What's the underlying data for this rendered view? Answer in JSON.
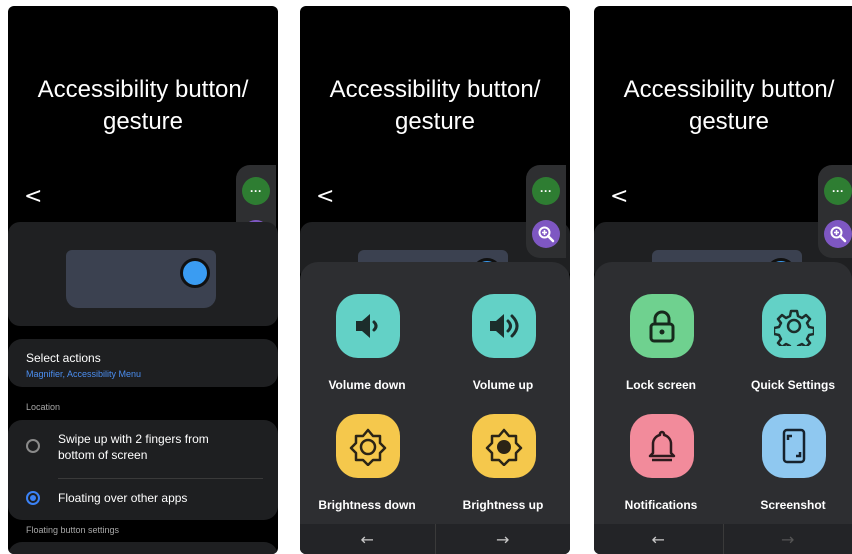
{
  "screen_title": "Accessibility button/ gesture",
  "title_line1": "Accessibility button/",
  "title_line2": "gesture",
  "back_glyph": "<",
  "float_menu_dots": "···",
  "settings": {
    "select_actions_title": "Select actions",
    "select_actions_value": "Magnifier, Accessibility Menu",
    "location_label": "Location",
    "option_swipe": "Swipe up with 2 fingers from bottom of screen",
    "option_floating": "Floating over other apps",
    "floating_settings_label": "Floating button settings"
  },
  "menu_page1": [
    {
      "label": "Volume down",
      "icon": "volume-down-icon",
      "color": "#63d1c6"
    },
    {
      "label": "Volume up",
      "icon": "volume-up-icon",
      "color": "#63d1c6"
    },
    {
      "label": "Brightness down",
      "icon": "brightness-down-icon",
      "color": "#f5c84c"
    },
    {
      "label": "Brightness up",
      "icon": "brightness-up-icon",
      "color": "#f5c84c"
    }
  ],
  "menu_page2": [
    {
      "label": "Lock screen",
      "icon": "lock-icon",
      "color": "#6fd18f"
    },
    {
      "label": "Quick Settings",
      "icon": "gear-icon",
      "color": "#63d1c6"
    },
    {
      "label": "Notifications",
      "icon": "bell-icon",
      "color": "#f28b9b"
    },
    {
      "label": "Screenshot",
      "icon": "screenshot-icon",
      "color": "#8fc8f0"
    }
  ],
  "nav": {
    "prev": "←",
    "next": "→"
  },
  "colors": {
    "accent": "#3b82f6",
    "link": "#4b8ef0",
    "background": "#000000"
  }
}
